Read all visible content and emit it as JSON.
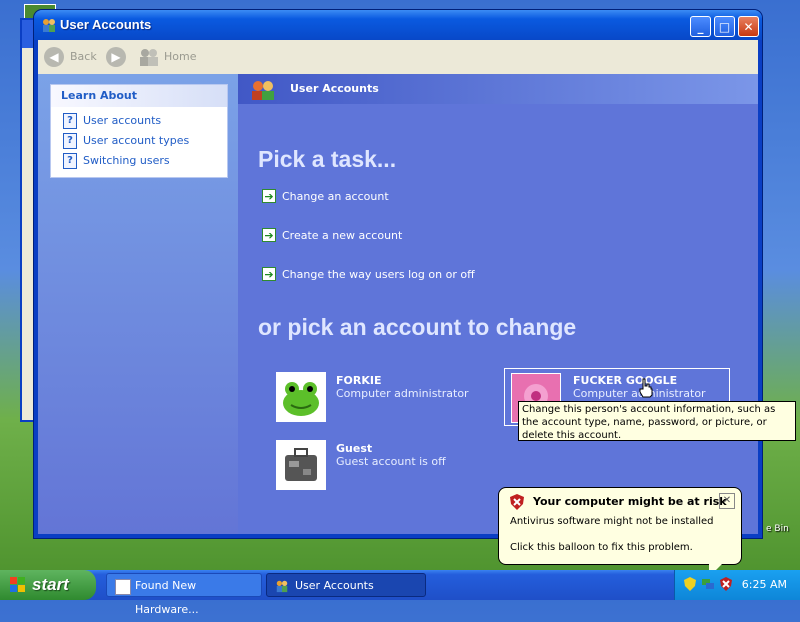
{
  "window": {
    "title": "User Accounts"
  },
  "toolbar": {
    "back": "Back",
    "home": "Home"
  },
  "left_pane": {
    "heading": "Learn About",
    "items": [
      "User accounts",
      "User account types",
      "Switching users"
    ]
  },
  "banner": {
    "title": "User Accounts"
  },
  "tasks": {
    "heading": "Pick a task...",
    "items": [
      "Change an account",
      "Create a new account",
      "Change the way users log on or off"
    ]
  },
  "accounts": {
    "heading": "or pick an account to change",
    "list": [
      {
        "name": "FORKIE",
        "role": "Computer administrator"
      },
      {
        "name": "FUCKER GOOGLE",
        "role": "Computer administrator"
      },
      {
        "name": "Guest",
        "role": "Guest account is off"
      }
    ]
  },
  "tooltip": {
    "text": "Change this person's account information, such as the account type, name, password, or picture, or delete this account."
  },
  "balloon": {
    "title": "Your computer might be at risk",
    "line1": "Antivirus software might not be installed",
    "line2": "Click this balloon to fix this problem."
  },
  "taskbar": {
    "start": "start",
    "tasks": [
      "Found New Hardware...",
      "User Accounts"
    ],
    "clock": "6:25 AM"
  },
  "colors": {
    "accent": "#0a3ec4",
    "content": "#6c86e4"
  }
}
